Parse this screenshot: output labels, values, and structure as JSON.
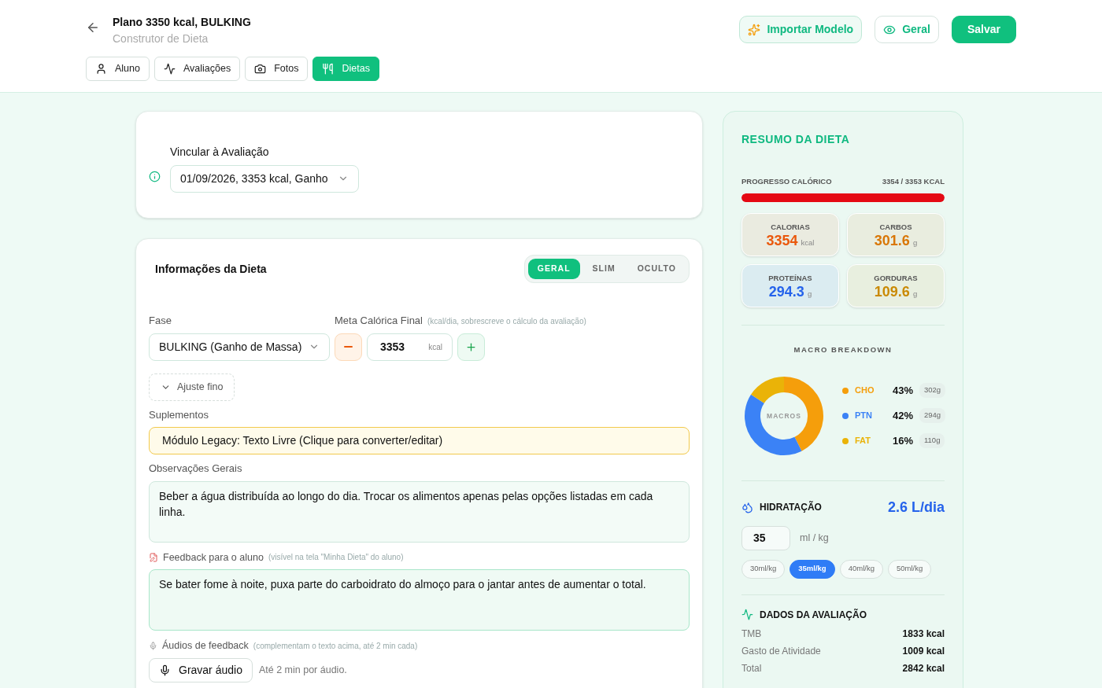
{
  "header": {
    "title": "Plano 3350 kcal, BULKING",
    "subtitle": "Construtor de Dieta",
    "actions": [
      {
        "kind": "import",
        "label": "Importar Modelo"
      },
      {
        "kind": "view",
        "label": "Geral"
      },
      {
        "kind": "save",
        "label": "Salvar"
      }
    ]
  },
  "tabs": [
    {
      "label": "Aluno",
      "selected": false
    },
    {
      "label": "Avaliações",
      "selected": false
    },
    {
      "label": "Fotos",
      "selected": false
    },
    {
      "label": "Dietas",
      "selected": true
    }
  ],
  "link_card": {
    "label": "Vincular à Avaliação",
    "value": "01/09/2026, 3353 kcal, Ganho"
  },
  "info_card": {
    "title": "Informações da Dieta",
    "modes": [
      {
        "label": "GERAL",
        "selected": true
      },
      {
        "label": "SLIM",
        "selected": false
      },
      {
        "label": "OCULTO",
        "selected": false
      }
    ],
    "phase": {
      "label": "Fase",
      "value": "BULKING (Ganho de Massa)"
    },
    "calorie_goal": {
      "label": "Meta Calórica Final",
      "hint": "(kcal/dia, sobrescreve o cálculo da avaliação)",
      "value": "3353",
      "unit": "kcal"
    },
    "fine_tune": {
      "label": "Ajuste fino",
      "expanded": false
    },
    "supplements": {
      "label": "Suplementos",
      "value": "Módulo Legacy: Texto Livre (Clique para converter/editar)"
    },
    "notes": {
      "label": "Observações Gerais",
      "value": "Beber a água distribuída ao longo do dia. Trocar os alimentos apenas pelas opções listadas em cada linha."
    },
    "feedback": {
      "label": "Feedback para o aluno",
      "hint": "(visível na tela \"Minha Dieta\" do aluno)",
      "value": "Se bater fome à noite, puxa parte do carboidrato do almoço para o jantar antes de aumentar o total."
    },
    "audios": {
      "label": "Áudios de feedback",
      "hint": "(complementam o texto acima, até 2 min cada)",
      "button": "Gravar áudio",
      "note": "Até 2 min por áudio."
    }
  },
  "summary": {
    "title": "RESUMO DA DIETA",
    "progress": {
      "label": "PROGRESSO CALÓRICO",
      "reading": "3354 / 3353 KCAL",
      "level": 1
    },
    "stats": [
      {
        "label": "CALORIAS",
        "value": "3354",
        "unit": "kcal",
        "color": "#ea580c"
      },
      {
        "label": "CARBOS",
        "value": "301.6",
        "unit": "g",
        "color": "#d97706"
      },
      {
        "label": "PROTEÍNAS",
        "value": "294.3",
        "unit": "g",
        "color": "#2563eb"
      },
      {
        "label": "GORDURAS",
        "value": "109.6",
        "unit": "g",
        "color": "#ca8a04"
      }
    ],
    "macro_title": "MACRO BREAKDOWN",
    "chart_data": {
      "type": "donut",
      "title": "MACROS",
      "values": [
        43,
        42,
        16
      ],
      "colors": [
        "#f59e0b",
        "#3b82f6",
        "#eab308"
      ]
    },
    "macros": [
      {
        "name": "CHO",
        "percent": "43%",
        "grams": "302g",
        "color": "#f59e0b"
      },
      {
        "name": "PTN",
        "percent": "42%",
        "grams": "294g",
        "color": "#3b82f6"
      },
      {
        "name": "FAT",
        "percent": "16%",
        "grams": "110g",
        "color": "#eab308"
      }
    ],
    "hydration": {
      "title": "HIDRATAÇÃO",
      "total": "2.6 L/dia",
      "value": "35",
      "unit": "ml / kg",
      "presets": [
        {
          "label": "30ml/kg",
          "selected": false
        },
        {
          "label": "35ml/kg",
          "selected": true
        },
        {
          "label": "40ml/kg",
          "selected": false
        },
        {
          "label": "50ml/kg",
          "selected": false
        }
      ]
    },
    "assessment": {
      "title": "DADOS DA AVALIAÇÃO",
      "rows": [
        {
          "label": "TMB",
          "value": "1833 kcal"
        },
        {
          "label": "Gasto de Atividade",
          "value": "1009 kcal"
        },
        {
          "label": "Total",
          "value": "2842 kcal"
        }
      ]
    }
  }
}
